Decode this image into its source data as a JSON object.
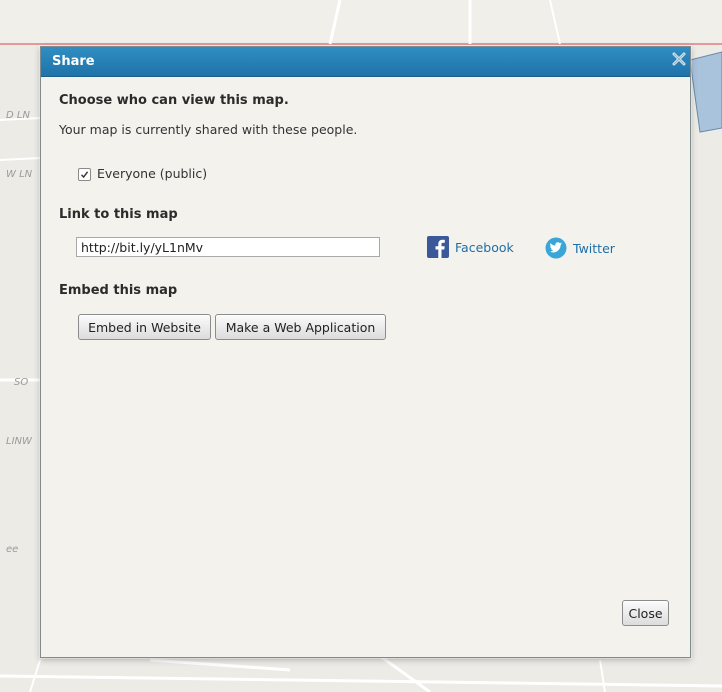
{
  "map": {
    "labels": [
      "D LN",
      "W LN",
      "SO",
      "LINW",
      "ee"
    ]
  },
  "dialog": {
    "title": "Share",
    "heading_view": "Choose who can view this map.",
    "shared_text": "Your map is currently shared with these people.",
    "everyone_label": "Everyone (public)",
    "everyone_checked": true,
    "heading_link": "Link to this map",
    "link_value": "http://bit.ly/yL1nMv",
    "facebook_label": "Facebook",
    "twitter_label": "Twitter",
    "heading_embed": "Embed this map",
    "embed_button": "Embed in Website",
    "webapp_button": "Make a Web Application",
    "close_button": "Close"
  },
  "colors": {
    "titlebar": "#2585bb",
    "dialog_bg": "#f3f2ed",
    "link": "#1e6fa8",
    "facebook": "#3b5998",
    "twitter": "#3aa6d8"
  }
}
